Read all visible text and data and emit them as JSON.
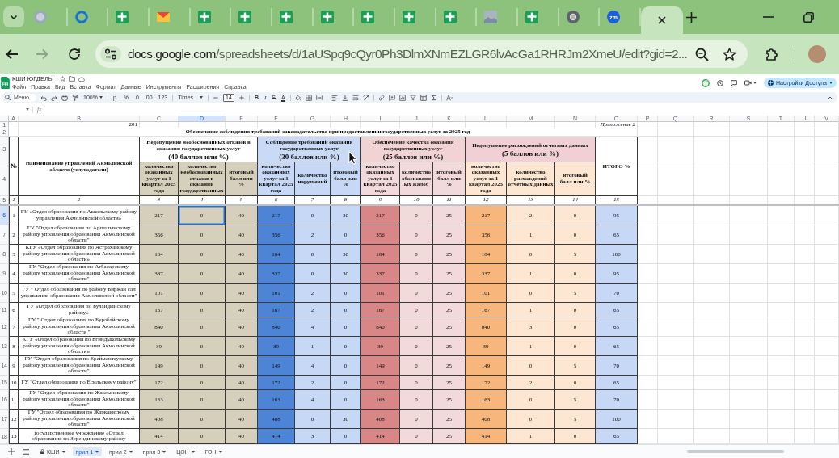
{
  "browser": {
    "tabs": [
      {
        "kind": "photo",
        "selected": false
      },
      {
        "kind": "ring",
        "selected": false
      },
      {
        "kind": "sheet",
        "selected": false
      },
      {
        "kind": "mail",
        "selected": false
      },
      {
        "kind": "sheet",
        "selected": false
      },
      {
        "kind": "sheet",
        "selected": false
      },
      {
        "kind": "sheet",
        "selected": false
      },
      {
        "kind": "sheet",
        "selected": false
      },
      {
        "kind": "sheet",
        "selected": false
      },
      {
        "kind": "sheet",
        "selected": false
      },
      {
        "kind": "sheet",
        "selected": false
      },
      {
        "kind": "image",
        "selected": false
      },
      {
        "kind": "sheet",
        "selected": false
      },
      {
        "kind": "chrome",
        "selected": false
      },
      {
        "kind": "zoom",
        "label": "zm",
        "selected": false
      },
      {
        "kind": "blank",
        "selected": true
      }
    ],
    "nav": [
      {
        "kind": "back",
        "disabled": false
      },
      {
        "kind": "forward",
        "disabled": true
      },
      {
        "kind": "reload",
        "disabled": false
      }
    ],
    "address": {
      "host": "docs.google.com",
      "path": "/spreadsheets/d/1aUSpq9cQyr0Ph3DlmXNmEZLGR6lvAcGa1RHRJm2XmeU/edit?gid=2..."
    }
  },
  "docs": {
    "title": "КШИ ЮГДЕЛЫ",
    "menu": [
      "Файл",
      "Правка",
      "Вид",
      "Вставка",
      "Формат",
      "Данные",
      "Инструменты",
      "Расширения",
      "Справка"
    ],
    "share": "Настройки Доступа",
    "toolbar": [
      {
        "kind": "search",
        "placeholder": "Меню"
      },
      {
        "kind": "undo"
      },
      {
        "kind": "redo"
      },
      {
        "kind": "print"
      },
      {
        "kind": "paint"
      },
      {
        "kind": "select",
        "label": "100%"
      },
      {
        "kind": "sep"
      },
      {
        "kind": "text",
        "label": "р."
      },
      {
        "kind": "text",
        "label": "%"
      },
      {
        "kind": "text",
        "label": ".0"
      },
      {
        "kind": "text",
        "label": ".00"
      },
      {
        "kind": "text",
        "label": "123"
      },
      {
        "kind": "sep"
      },
      {
        "kind": "select",
        "label": "Times..."
      },
      {
        "kind": "sep"
      },
      {
        "kind": "minus"
      },
      {
        "kind": "field",
        "value": "14"
      },
      {
        "kind": "plus"
      },
      {
        "kind": "sep"
      },
      {
        "kind": "bold",
        "label": "B"
      },
      {
        "kind": "italic",
        "label": "I"
      },
      {
        "kind": "strike",
        "label": "S"
      },
      {
        "kind": "color",
        "label": "A"
      },
      {
        "kind": "sep"
      },
      {
        "kind": "fill"
      },
      {
        "kind": "borders"
      },
      {
        "kind": "merge"
      },
      {
        "kind": "sep"
      },
      {
        "kind": "align"
      },
      {
        "kind": "valign"
      },
      {
        "kind": "wrap"
      },
      {
        "kind": "rotate"
      },
      {
        "kind": "sep"
      },
      {
        "kind": "link"
      },
      {
        "kind": "comment"
      },
      {
        "kind": "chart"
      },
      {
        "kind": "filter"
      },
      {
        "kind": "views"
      },
      {
        "kind": "functions"
      },
      {
        "kind": "sep"
      },
      {
        "kind": "input"
      }
    ],
    "formula_label": "fx"
  },
  "sheet": {
    "columns": [
      {
        "label": "A",
        "selected": false
      },
      {
        "label": "B",
        "selected": false
      },
      {
        "label": "C",
        "selected": false
      },
      {
        "label": "D",
        "selected": true
      },
      {
        "label": "E",
        "selected": false
      },
      {
        "label": "F",
        "selected": false
      },
      {
        "label": "G",
        "selected": false
      },
      {
        "label": "H",
        "selected": false
      },
      {
        "label": "I",
        "selected": false
      },
      {
        "label": "J",
        "selected": false
      },
      {
        "label": "K",
        "selected": false
      },
      {
        "label": "L",
        "selected": false
      },
      {
        "label": "M",
        "selected": false
      },
      {
        "label": "N",
        "selected": false
      },
      {
        "label": "O",
        "selected": false
      },
      {
        "label": "P",
        "selected": false
      },
      {
        "label": "Q",
        "selected": false
      },
      {
        "label": "R",
        "selected": false
      },
      {
        "label": "S",
        "selected": false
      },
      {
        "label": "T",
        "selected": false
      },
      {
        "label": "U",
        "selected": false
      },
      {
        "label": "V",
        "selected": false
      }
    ],
    "rows": [
      {
        "label": "1",
        "selected": false
      },
      {
        "label": "2",
        "selected": false
      },
      {
        "label": "3",
        "selected": false
      },
      {
        "label": "4",
        "selected": false
      },
      {
        "label": "5",
        "selected": false
      },
      {
        "label": "6",
        "selected": true
      },
      {
        "label": "7",
        "selected": false
      },
      {
        "label": "8",
        "selected": false
      },
      {
        "label": "9",
        "selected": false
      },
      {
        "label": "10",
        "selected": false
      },
      {
        "label": "11",
        "selected": false
      },
      {
        "label": "12",
        "selected": false
      },
      {
        "label": "13",
        "selected": false
      },
      {
        "label": "14",
        "selected": false
      },
      {
        "label": "15",
        "selected": false
      },
      {
        "label": "16",
        "selected": false
      },
      {
        "label": "17",
        "selected": false
      },
      {
        "label": "18",
        "selected": false
      }
    ]
  },
  "report": {
    "year": "201",
    "appendix": "Приложение 2",
    "title": "Обеспечение соблюдения требований законодательства при предоставлении государственных услуг за 2025 год",
    "number_header": "№",
    "name_header": "Наименование управлений Акмолинской области (услугодатели)",
    "groups": [
      {
        "title": "Недопущение необоснованных отказов в оказании государственных услуг",
        "points": "(40 баллов или %)",
        "color": "#ffffff",
        "columns": [
          {
            "header": {
              "label": "количество оказанных услуг за 1 квартал 2025 года",
              "color": "#d6cfbb"
            },
            "color": "#d6cfbb"
          },
          {
            "header": {
              "label": "количество необоснованных отказов в оказании государственных",
              "color": "#d6cfbb"
            },
            "color": "#d6cfbb"
          },
          {
            "header": {
              "label": "итоговый балл или %",
              "color": "#d6cfbb"
            },
            "color": "#d6cfbb"
          }
        ]
      },
      {
        "title": "Соблюдение требований оказания государственных услуг",
        "points": "(30 баллов или %)",
        "color": "#c8daf6",
        "columns": [
          {
            "header": {
              "label": "количество оказанных услуг за 1 квартал 2025 года",
              "color": "#c6d8f5"
            },
            "color": "#4d84d6"
          },
          {
            "header": {
              "label": "количество нарушений",
              "color": "#c6d8f5"
            },
            "color": "#c6d8f5"
          },
          {
            "header": {
              "label": "итоговый балл или %",
              "color": "#c6d8f5"
            },
            "color": "#c6d8f5"
          }
        ]
      },
      {
        "title": "Обеспечение качества оказания государственных услуг",
        "points": "(25 баллов или %)",
        "color": "#f1d3d3",
        "columns": [
          {
            "header": {
              "label": "количество оказанных услуг за 1 квартал 2025 года",
              "color": "#f3dada"
            },
            "color": "#d88686"
          },
          {
            "header": {
              "label": "количество обоснованных жалоб",
              "color": "#f3dada"
            },
            "color": "#f3dada"
          },
          {
            "header": {
              "label": "итоговый балл или %",
              "color": "#f3dada"
            },
            "color": "#f3dada"
          }
        ]
      },
      {
        "title": "Недопущение расхождений отчетных данных",
        "points": "(5 баллов или %)",
        "color": "#f0d0d4",
        "columns": [
          {
            "header": {
              "label": "количество оказанных услуг за 1 квартал 2025 года",
              "color": "#fde6d2"
            },
            "color": "#f7b77c"
          },
          {
            "header": {
              "label": "количество расхождений отчетных данных",
              "color": "#fde6d2"
            },
            "color": "#fde6d2"
          },
          {
            "header": {
              "label": "итоговый балл или %",
              "color": "#fde6d2"
            },
            "color": "#fde6d2"
          }
        ]
      }
    ],
    "total": {
      "header": "ИТОГО %",
      "color": "#c6d8f5"
    },
    "column_numbers": [
      "1",
      "2",
      "3",
      "4",
      "5",
      "6",
      "7",
      "8",
      "9",
      "10",
      "11",
      "12",
      "13",
      "14",
      "15"
    ],
    "rows": [
      {
        "number": "1",
        "name": "ГУ «Отдел образования по Аккольскому району управления Акмолинской области»",
        "values": [
          "217",
          "0",
          "40",
          "217",
          "0",
          "30",
          "217",
          "0",
          "25",
          "217",
          "2",
          "0"
        ],
        "total": "95"
      },
      {
        "number": "2",
        "name": "ГУ \"Отдел образования по Аршалынскому району управления образования Акмолинской области\"",
        "values": [
          "356",
          "0",
          "40",
          "356",
          "2",
          "0",
          "356",
          "0",
          "25",
          "356",
          "1",
          "0"
        ],
        "total": "65"
      },
      {
        "number": "3",
        "name": "КГУ «Отдел образования по Астраханскому району управления образования Акмолинской области»",
        "values": [
          "184",
          "0",
          "40",
          "184",
          "0",
          "30",
          "184",
          "0",
          "25",
          "184",
          "0",
          "5"
        ],
        "total": "100"
      },
      {
        "number": "4",
        "name": "ГУ \"Отдел образования по Атбасарскому району управления образования Акмолинской области\"",
        "values": [
          "337",
          "0",
          "40",
          "337",
          "0",
          "30",
          "337",
          "0",
          "25",
          "337",
          "1",
          "0"
        ],
        "total": "95"
      },
      {
        "number": "5",
        "name": "ГУ \" Отдел образования по району Биржан сал управления образования Акмолинской области\"",
        "values": [
          "101",
          "0",
          "40",
          "101",
          "2",
          "0",
          "101",
          "0",
          "25",
          "101",
          "0",
          "5"
        ],
        "total": "70"
      },
      {
        "number": "6",
        "name": "ГУ «Отдел образования по Буландынскому району»",
        "values": [
          "167",
          "0",
          "40",
          "167",
          "2",
          "0",
          "167",
          "0",
          "25",
          "167",
          "1",
          "0"
        ],
        "total": "65"
      },
      {
        "number": "7",
        "name": "ГУ \" Отдел образования по Бурабайскому району управления образования Акмолинской области \"",
        "values": [
          "840",
          "0",
          "40",
          "840",
          "4",
          "0",
          "840",
          "0",
          "25",
          "840",
          "3",
          "0"
        ],
        "total": "65"
      },
      {
        "number": "8",
        "name": "КГУ «Отдел образования по Егиндыкольскому району управления образования Акмолинской области»",
        "values": [
          "39",
          "0",
          "40",
          "39",
          "1",
          "0",
          "39",
          "0",
          "25",
          "39",
          "1",
          "0"
        ],
        "total": "65"
      },
      {
        "number": "9",
        "name": "ГУ \"Отдел образования по Ерейментаускому району управления образования Акмолинской области\"",
        "values": [
          "149",
          "0",
          "40",
          "149",
          "4",
          "0",
          "149",
          "0",
          "25",
          "149",
          "0",
          "5"
        ],
        "total": "70"
      },
      {
        "number": "10",
        "name": "ГУ \"Отдел образования по Есильскому району\"",
        "values": [
          "172",
          "0",
          "40",
          "172",
          "2",
          "0",
          "172",
          "0",
          "25",
          "172",
          "2",
          "0"
        ],
        "total": "65"
      },
      {
        "number": "11",
        "name": "ГУ \"Отдел образования по Жаксынскому району управления образования Акмолинской области\"",
        "values": [
          "163",
          "0",
          "40",
          "163",
          "4",
          "0",
          "163",
          "0",
          "25",
          "163",
          "0",
          "5"
        ],
        "total": "70"
      },
      {
        "number": "12",
        "name": "ГУ \"Отдел образования по Жаркаинскому району управления образования Акмолинской области\"",
        "values": [
          "408",
          "0",
          "40",
          "408",
          "0",
          "30",
          "408",
          "0",
          "25",
          "408",
          "0",
          "5"
        ],
        "total": "100"
      },
      {
        "number": "13",
        "name": "государственное учреждение «Отдел образования по Зерендинскому району",
        "values": [
          "414",
          "0",
          "40",
          "414",
          "3",
          "0",
          "414",
          "0",
          "25",
          "414",
          "1",
          "0"
        ],
        "total": "65"
      }
    ]
  },
  "sheet_tabs": [
    {
      "label": "КШИ",
      "locked": true,
      "selected": false
    },
    {
      "label": "прил 1",
      "locked": false,
      "selected": true
    },
    {
      "label": "прил 2",
      "locked": false,
      "selected": false
    },
    {
      "label": "прил 3",
      "locked": false,
      "selected": false
    },
    {
      "label": "ЦОН",
      "locked": false,
      "selected": false
    },
    {
      "label": "ГОН",
      "locked": false,
      "selected": false
    }
  ]
}
